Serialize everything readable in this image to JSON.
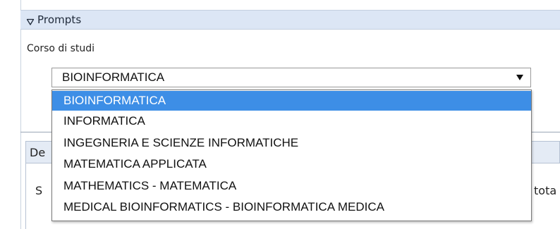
{
  "prompts": {
    "title": "Prompts"
  },
  "field": {
    "label": "Corso di studi",
    "selected_value": "BIOINFORMATICA"
  },
  "dropdown": {
    "options": [
      {
        "label": "BIOINFORMATICA",
        "selected": true
      },
      {
        "label": "INFORMATICA",
        "selected": false
      },
      {
        "label": "INGEGNERIA E SCIENZE INFORMATICHE",
        "selected": false
      },
      {
        "label": "MATEMATICA APPLICATA",
        "selected": false
      },
      {
        "label": "MATHEMATICS - MATEMATICA",
        "selected": false
      },
      {
        "label": "MEDICAL BIOINFORMATICS - BIOINFORMATICA MEDICA",
        "selected": false
      }
    ]
  },
  "panel2": {
    "header_fragment": "De",
    "body_fragment": "S",
    "right_fragment": "tota"
  },
  "colors": {
    "header_bg": "#dce6f5",
    "selected_bg": "#3d8ee6",
    "selected_text": "#ffffff"
  },
  "icons": {
    "collapse": "triangle-down-outline-icon",
    "select_arrow": "triangle-down-solid-icon"
  }
}
